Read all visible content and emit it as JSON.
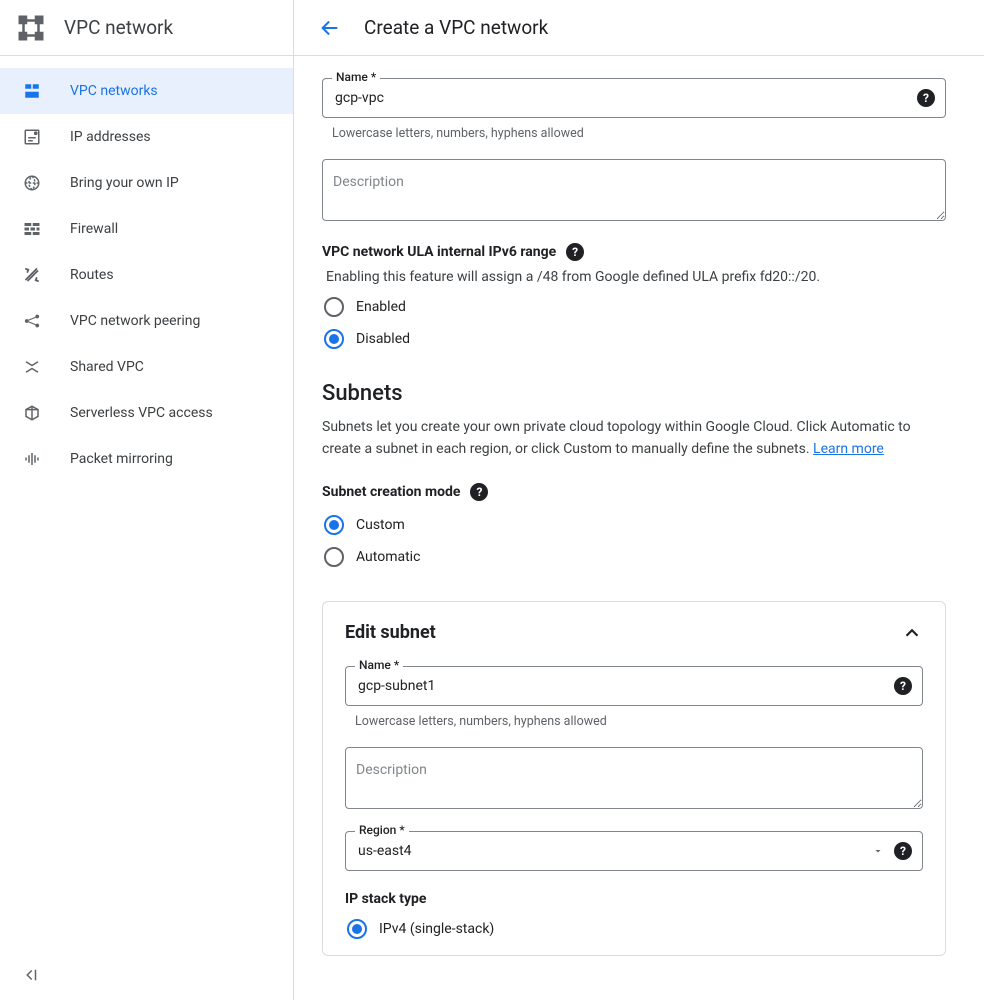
{
  "sidebar": {
    "title": "VPC network",
    "items": [
      {
        "label": "VPC networks"
      },
      {
        "label": "IP addresses"
      },
      {
        "label": "Bring your own IP"
      },
      {
        "label": "Firewall"
      },
      {
        "label": "Routes"
      },
      {
        "label": "VPC network peering"
      },
      {
        "label": "Shared VPC"
      },
      {
        "label": "Serverless VPC access"
      },
      {
        "label": "Packet mirroring"
      }
    ]
  },
  "header": {
    "title": "Create a VPC network"
  },
  "form": {
    "name_label": "Name *",
    "name_value": "gcp-vpc",
    "name_helper": "Lowercase letters, numbers, hyphens allowed",
    "description_placeholder": "Description",
    "ula_label": "VPC network ULA internal IPv6 range",
    "ula_desc": "Enabling this feature will assign a /48 from Google defined ULA prefix fd20::/20.",
    "ula_options": {
      "enabled": "Enabled",
      "disabled": "Disabled"
    },
    "subnets_heading": "Subnets",
    "subnets_desc": "Subnets let you create your own private cloud topology within Google Cloud. Click Automatic to create a subnet in each region, or click Custom to manually define the subnets. ",
    "learn_more": "Learn more",
    "subnet_mode_label": "Subnet creation mode",
    "subnet_mode_options": {
      "custom": "Custom",
      "automatic": "Automatic"
    }
  },
  "subnet": {
    "card_title": "Edit subnet",
    "name_label": "Name *",
    "name_value": "gcp-subnet1",
    "name_helper": "Lowercase letters, numbers, hyphens allowed",
    "description_placeholder": "Description",
    "region_label": "Region *",
    "region_value": "us-east4",
    "ip_stack_label": "IP stack type",
    "ip_stack_options": {
      "ipv4": "IPv4 (single-stack)"
    }
  }
}
